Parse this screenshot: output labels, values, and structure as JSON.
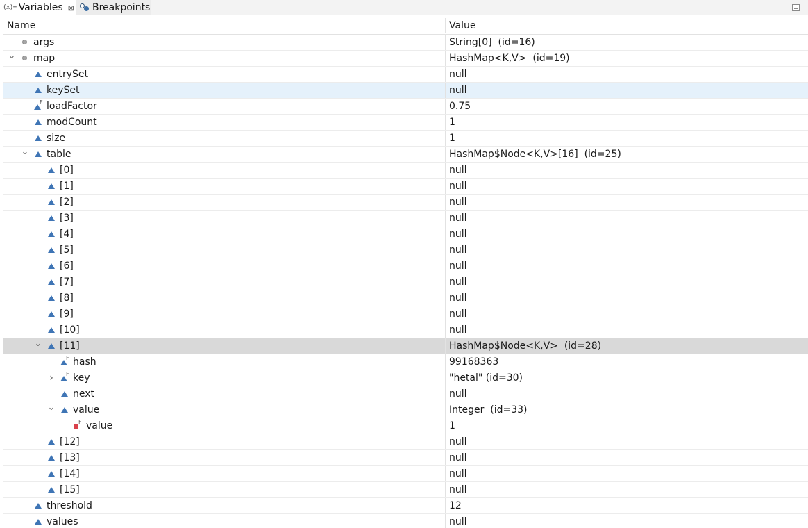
{
  "tabs": {
    "variables": {
      "prefix": "(x)=",
      "label": "Variables",
      "close": "⊠"
    },
    "breakpoints": {
      "label": "Breakpoints"
    }
  },
  "columns": {
    "name": "Name",
    "value": "Value"
  },
  "rows": [
    {
      "depth": 0,
      "twisty": "",
      "icon": "circle-icon",
      "name": "args",
      "value": "String[0]  (id=16)",
      "state": ""
    },
    {
      "depth": 0,
      "twisty": "expanded",
      "icon": "circle-icon",
      "name": "map",
      "value": "HashMap<K,V>  (id=19)",
      "state": ""
    },
    {
      "depth": 1,
      "twisty": "",
      "icon": "triangle-icon",
      "name": "entrySet",
      "value": "null",
      "state": ""
    },
    {
      "depth": 1,
      "twisty": "",
      "icon": "triangle-icon",
      "name": "keySet",
      "value": "null",
      "state": "selected-light"
    },
    {
      "depth": 1,
      "twisty": "",
      "icon": "triangle-final-icon",
      "name": "loadFactor",
      "value": "0.75",
      "state": ""
    },
    {
      "depth": 1,
      "twisty": "",
      "icon": "triangle-icon",
      "name": "modCount",
      "value": "1",
      "state": ""
    },
    {
      "depth": 1,
      "twisty": "",
      "icon": "triangle-icon",
      "name": "size",
      "value": "1",
      "state": ""
    },
    {
      "depth": 1,
      "twisty": "expanded",
      "icon": "triangle-icon",
      "name": "table",
      "value": "HashMap$Node<K,V>[16]  (id=25)",
      "state": ""
    },
    {
      "depth": 2,
      "twisty": "",
      "icon": "triangle-icon",
      "name": "[0]",
      "value": "null",
      "state": ""
    },
    {
      "depth": 2,
      "twisty": "",
      "icon": "triangle-icon",
      "name": "[1]",
      "value": "null",
      "state": ""
    },
    {
      "depth": 2,
      "twisty": "",
      "icon": "triangle-icon",
      "name": "[2]",
      "value": "null",
      "state": ""
    },
    {
      "depth": 2,
      "twisty": "",
      "icon": "triangle-icon",
      "name": "[3]",
      "value": "null",
      "state": ""
    },
    {
      "depth": 2,
      "twisty": "",
      "icon": "triangle-icon",
      "name": "[4]",
      "value": "null",
      "state": ""
    },
    {
      "depth": 2,
      "twisty": "",
      "icon": "triangle-icon",
      "name": "[5]",
      "value": "null",
      "state": ""
    },
    {
      "depth": 2,
      "twisty": "",
      "icon": "triangle-icon",
      "name": "[6]",
      "value": "null",
      "state": ""
    },
    {
      "depth": 2,
      "twisty": "",
      "icon": "triangle-icon",
      "name": "[7]",
      "value": "null",
      "state": ""
    },
    {
      "depth": 2,
      "twisty": "",
      "icon": "triangle-icon",
      "name": "[8]",
      "value": "null",
      "state": ""
    },
    {
      "depth": 2,
      "twisty": "",
      "icon": "triangle-icon",
      "name": "[9]",
      "value": "null",
      "state": ""
    },
    {
      "depth": 2,
      "twisty": "",
      "icon": "triangle-icon",
      "name": "[10]",
      "value": "null",
      "state": ""
    },
    {
      "depth": 2,
      "twisty": "expanded",
      "icon": "triangle-icon",
      "name": "[11]",
      "value": "HashMap$Node<K,V>  (id=28)",
      "state": "selected-gray"
    },
    {
      "depth": 3,
      "twisty": "",
      "icon": "triangle-final-icon",
      "name": "hash",
      "value": "99168363",
      "state": ""
    },
    {
      "depth": 3,
      "twisty": "collapsed",
      "icon": "triangle-final-icon",
      "name": "key",
      "value": "\"hetal\" (id=30)",
      "state": ""
    },
    {
      "depth": 3,
      "twisty": "",
      "icon": "triangle-icon",
      "name": "next",
      "value": "null",
      "state": ""
    },
    {
      "depth": 3,
      "twisty": "expanded",
      "icon": "triangle-icon",
      "name": "value",
      "value": "Integer  (id=33)",
      "state": ""
    },
    {
      "depth": 4,
      "twisty": "",
      "icon": "private-final-icon",
      "name": "value",
      "value": "1",
      "state": ""
    },
    {
      "depth": 2,
      "twisty": "",
      "icon": "triangle-icon",
      "name": "[12]",
      "value": "null",
      "state": ""
    },
    {
      "depth": 2,
      "twisty": "",
      "icon": "triangle-icon",
      "name": "[13]",
      "value": "null",
      "state": ""
    },
    {
      "depth": 2,
      "twisty": "",
      "icon": "triangle-icon",
      "name": "[14]",
      "value": "null",
      "state": ""
    },
    {
      "depth": 2,
      "twisty": "",
      "icon": "triangle-icon",
      "name": "[15]",
      "value": "null",
      "state": ""
    },
    {
      "depth": 1,
      "twisty": "",
      "icon": "triangle-icon",
      "name": "threshold",
      "value": "12",
      "state": ""
    },
    {
      "depth": 1,
      "twisty": "",
      "icon": "triangle-icon",
      "name": "values",
      "value": "null",
      "state": ""
    }
  ]
}
